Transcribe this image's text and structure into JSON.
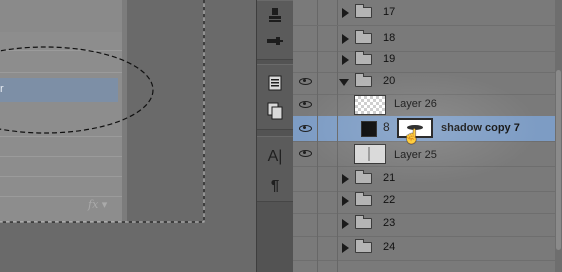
{
  "canvas": {
    "selected_row_text": "r",
    "fx_label": "fx ▾"
  },
  "tools": {
    "icons": [
      "stamp-tool-icon",
      "brush-settings-icon",
      "layer-comps-icon",
      "clone-source-icon",
      "character-icon",
      "paragraph-icon"
    ],
    "character_glyph": "A|",
    "paragraph_glyph": "¶"
  },
  "layers": {
    "rows": [
      {
        "label": "17",
        "kind": "group",
        "expanded": false,
        "visible": false
      },
      {
        "label": "18",
        "kind": "group",
        "expanded": false,
        "visible": false
      },
      {
        "label": "19",
        "kind": "group",
        "expanded": false,
        "visible": false
      },
      {
        "label": "20",
        "kind": "group",
        "expanded": true,
        "visible": true
      },
      {
        "label": "Layer 26",
        "kind": "layer",
        "visible": true
      },
      {
        "label": "shadow copy 7",
        "kind": "masked-layer",
        "visible": true,
        "selected": true
      },
      {
        "label": "Layer 25",
        "kind": "layer",
        "visible": true
      },
      {
        "label": "21",
        "kind": "group",
        "expanded": false,
        "visible": false
      },
      {
        "label": "22",
        "kind": "group",
        "expanded": false,
        "visible": false
      },
      {
        "label": "23",
        "kind": "group",
        "expanded": false,
        "visible": false
      },
      {
        "label": "24",
        "kind": "group",
        "expanded": false,
        "visible": false
      }
    ],
    "link_glyph": "8",
    "cursor_glyph": "☝"
  },
  "colors": {
    "selection": "#7d9cc4",
    "panel": "#7a7a7a"
  }
}
